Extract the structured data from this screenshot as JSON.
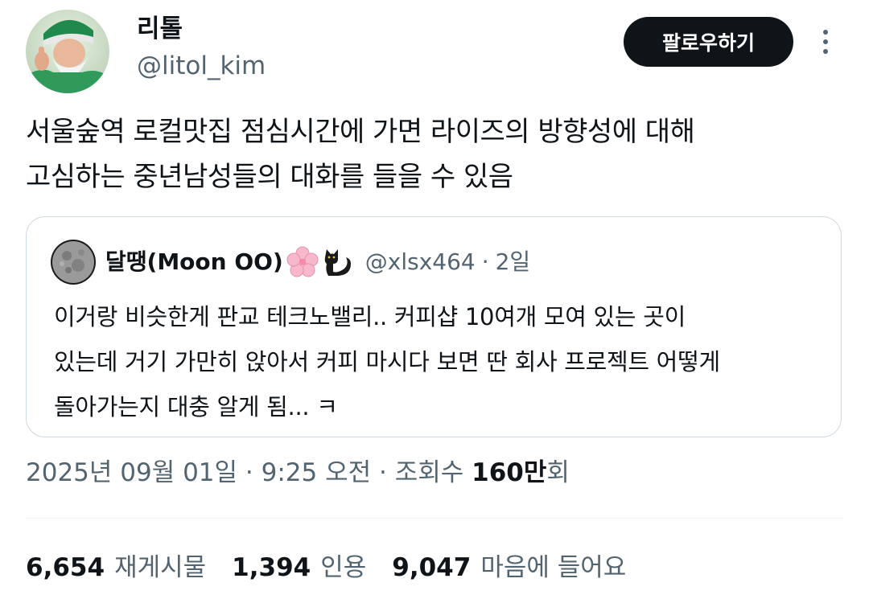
{
  "author": {
    "display_name": "리톨",
    "handle": "@litol_kim"
  },
  "follow_button": {
    "label": "팔로우하기"
  },
  "tweet": {
    "text": "서울숲역 로컬맛집 점심시간에 가면 라이즈의 방향성에 대해\n고심하는 중년남성들의 대화를 들을 수 있음"
  },
  "quote": {
    "author_name": "달땡(Moon OO)",
    "author_emojis": [
      "cherry-blossom",
      "black-cat"
    ],
    "handle": "@xlsx464",
    "separator": "·",
    "time": "2일",
    "text": "이거랑 비슷한게 판교 테크노밸리.. 커피샵 10여개 모여 있는 곳이\n있는데 거기 가만히 앉아서 커피 마시다 보면 딴 회사 프로젝트 어떻게\n돌아가는지 대충 알게 됨... ㅋ"
  },
  "meta": {
    "date": "2025년 09월 01일",
    "separator": " · ",
    "time": "9:25 오전",
    "views_label": "조회수 ",
    "views_number": "160만",
    "views_suffix": "회"
  },
  "stats": {
    "retweets": {
      "number": "6,654",
      "label": "재게시물"
    },
    "quotes": {
      "number": "1,394",
      "label": "인용"
    },
    "likes": {
      "number": "9,047",
      "label": "마음에 들어요"
    }
  },
  "colors": {
    "text_primary": "#0f1419",
    "text_secondary": "#536471",
    "border": "#cfd9de",
    "button_bg": "#0f1419"
  }
}
